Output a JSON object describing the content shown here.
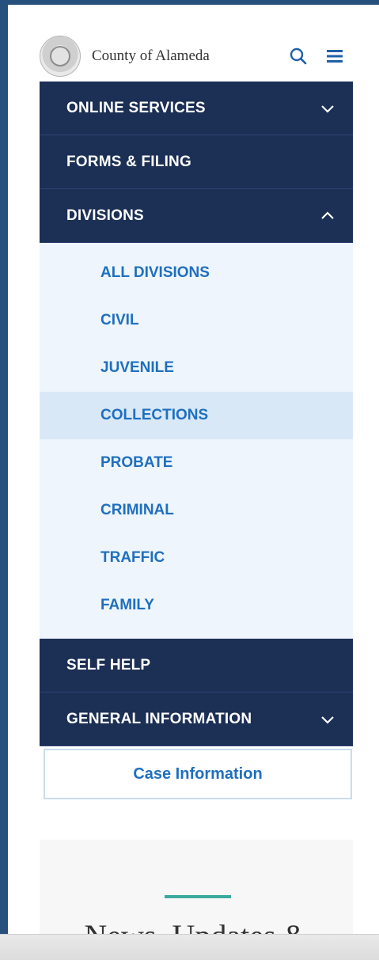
{
  "header": {
    "brand": "County of Alameda",
    "icons": [
      "county-seal-logo",
      "search-icon",
      "menu-icon"
    ]
  },
  "nav": {
    "online_services": "ONLINE SERVICES",
    "forms_filing": "FORMS & FILING",
    "divisions": "DIVISIONS",
    "divisions_items": [
      "ALL DIVISIONS",
      "CIVIL",
      "JUVENILE",
      "COLLECTIONS",
      "PROBATE",
      "CRIMINAL",
      "TRAFFIC",
      "FAMILY"
    ],
    "active_item": "COLLECTIONS",
    "self_help": "SELF HELP",
    "general_information": "GENERAL INFORMATION"
  },
  "case_button": "Case Information",
  "news_heading": "News, Updates &",
  "colors": {
    "nav_bg": "#1c2f55",
    "submenu_bg": "#eef5fc",
    "link_blue": "#1f6fbf",
    "accent_teal": "#3aa9a0",
    "outer_bg": "#27507c"
  }
}
